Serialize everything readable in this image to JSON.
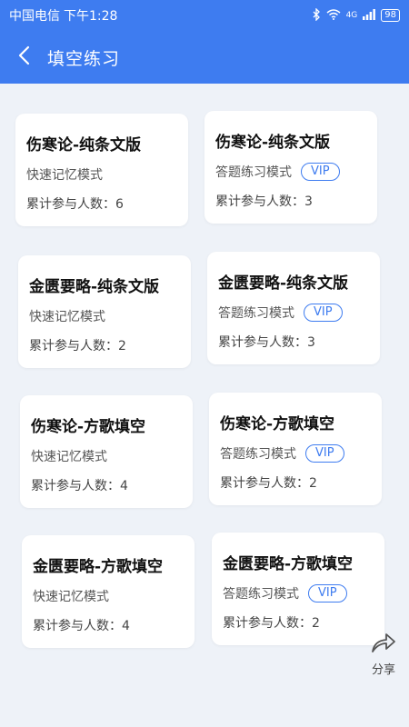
{
  "status_bar": {
    "carrier": "中国电信",
    "time": "下午1:28",
    "network": "4G",
    "battery": "98"
  },
  "header": {
    "title": "填空练习"
  },
  "cards": [
    {
      "title": "伤寒论-纯条文版",
      "mode": "快速记忆模式",
      "vip": "",
      "count": "累计参与人数：6"
    },
    {
      "title": "伤寒论-纯条文版",
      "mode": "答题练习模式",
      "vip": "VIP",
      "count": "累计参与人数：3"
    },
    {
      "title": "金匮要略-纯条文版",
      "mode": "快速记忆模式",
      "vip": "",
      "count": "累计参与人数：2"
    },
    {
      "title": "金匮要略-纯条文版",
      "mode": "答题练习模式",
      "vip": "VIP",
      "count": "累计参与人数：3"
    },
    {
      "title": "伤寒论-方歌填空",
      "mode": "快速记忆模式",
      "vip": "",
      "count": "累计参与人数：4"
    },
    {
      "title": "伤寒论-方歌填空",
      "mode": "答题练习模式",
      "vip": "VIP",
      "count": "累计参与人数：2"
    },
    {
      "title": "金匮要略-方歌填空",
      "mode": "快速记忆模式",
      "vip": "",
      "count": "累计参与人数：4"
    },
    {
      "title": "金匮要略-方歌填空",
      "mode": "答题练习模式",
      "vip": "VIP",
      "count": "累计参与人数：2"
    }
  ],
  "share": {
    "label": "分享"
  },
  "colors": {
    "primary": "#3e7cf0",
    "background": "#eef2f8"
  },
  "icons": [
    "back-arrow-icon",
    "bluetooth-icon",
    "wifi-icon",
    "battery-icon",
    "share-icon"
  ]
}
